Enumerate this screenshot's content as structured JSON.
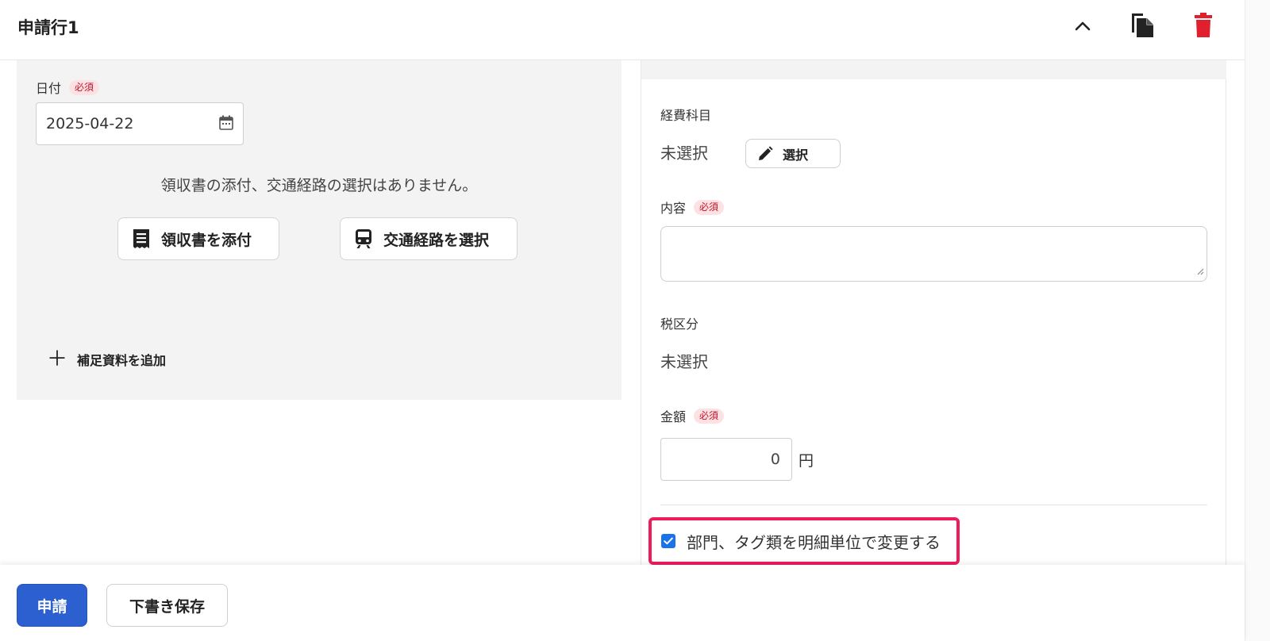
{
  "header": {
    "title": "申請行1",
    "collapse_icon": "chevron-up-icon",
    "copy_icon": "copy-icon",
    "delete_icon": "trash-icon",
    "delete_color": "#e0202d"
  },
  "left": {
    "date_label": "日付",
    "required_badge": "必須",
    "date_value": "2025-04-22",
    "calendar_icon": "calendar-icon",
    "no_attachment_text": "領収書の添付、交通経路の選択はありません。",
    "attach_receipt_label": "領収書を添付",
    "receipt_icon": "receipt-icon",
    "select_route_label": "交通経路を選択",
    "train_icon": "train-icon",
    "add_material_label": "補足資料を追加",
    "add_icon": "plus-icon"
  },
  "right": {
    "expense_item_label": "経費科目",
    "expense_item_value": "未選択",
    "select_button_label": "選択",
    "pencil_icon": "pencil-icon",
    "content_label": "内容",
    "content_required_badge": "必須",
    "content_value": "",
    "tax_label": "税区分",
    "tax_value": "未選択",
    "amount_label": "金額",
    "amount_required_badge": "必須",
    "amount_value": "0",
    "amount_unit": "円",
    "dept_tag_checkbox_label": "部門、タグ類を明細単位で変更する",
    "dept_tag_checked": true,
    "highlight_color": "#ee1c5d"
  },
  "footer": {
    "submit_label": "申請",
    "save_draft_label": "下書き保存",
    "primary_color": "#2c5fcf"
  }
}
